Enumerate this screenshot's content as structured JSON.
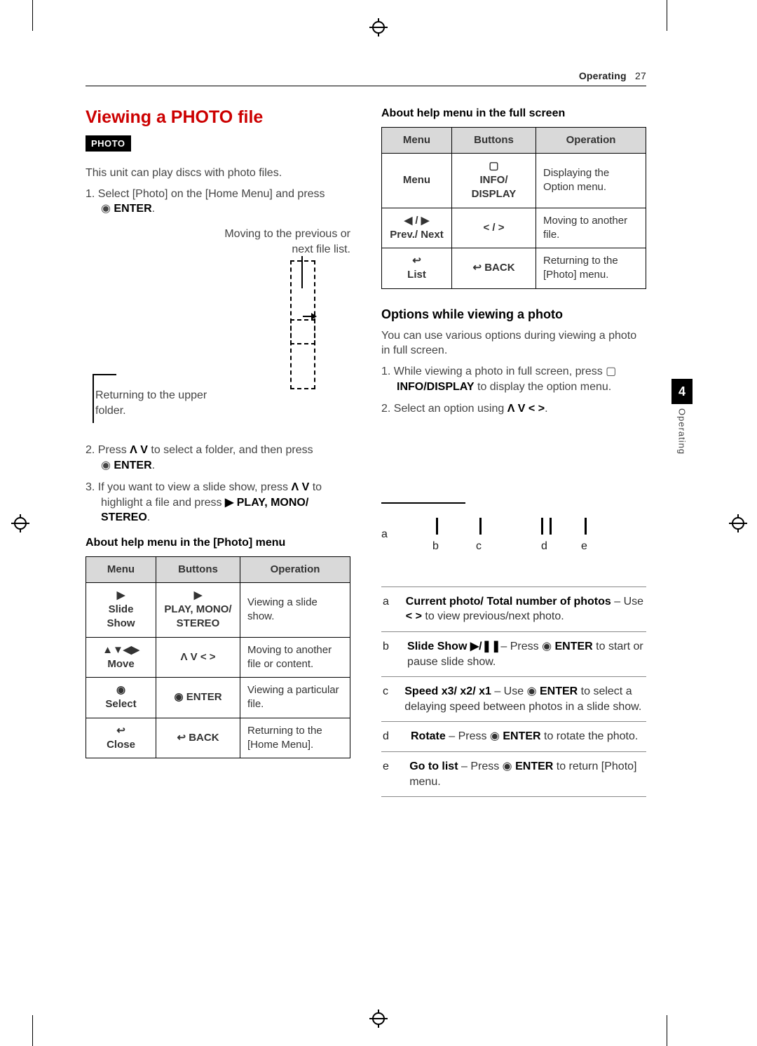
{
  "running_head": {
    "section": "Operating",
    "page": "27"
  },
  "side_tab": {
    "number": "4",
    "label": "Operating"
  },
  "left": {
    "title": "Viewing a PHOTO file",
    "badge": "PHOTO",
    "intro": "This unit can play discs with photo files.",
    "step1_num": "1.",
    "step1_a": "Select [Photo] on the [Home Menu] and press ",
    "step1_enter": "ENTER",
    "step1_b": ".",
    "diagram_cap1": "Moving to the previous or next file list.",
    "diagram_cap2": "Returning to the upper folder.",
    "step2_num": "2.",
    "step2_a": "Press ",
    "step2_sym": "Λ V",
    "step2_b": " to select a folder, and then press ",
    "step2_enter": "ENTER",
    "step2_c": ".",
    "step3_num": "3.",
    "step3_a": "If you want to view a slide show, press ",
    "step3_sym": "Λ V",
    "step3_b": " to highlight a file and press ",
    "step3_play_sym": "▶",
    "step3_play": " PLAY, MONO/ STEREO",
    "step3_c": ".",
    "table1_title": "About help menu in the [Photo] menu",
    "table1": {
      "h1": "Menu",
      "h2": "Buttons",
      "h3": "Operation",
      "r1c1_sym": "▶",
      "r1c1": "Slide Show",
      "r1c2_sym": "▶",
      "r1c2": "PLAY, MONO/ STEREO",
      "r1c3": "Viewing a slide show.",
      "r2c1_sym": "▲▼◀▶",
      "r2c1": "Move",
      "r2c2": "Λ V < >",
      "r2c3": "Moving to another file or content.",
      "r3c1_sym": "◉",
      "r3c1": "Select",
      "r3c2_sym": "◉",
      "r3c2": "ENTER",
      "r3c3": "Viewing a particular file.",
      "r4c1_sym": "↩",
      "r4c1": "Close",
      "r4c2_sym": "↩",
      "r4c2": "BACK",
      "r4c3": "Returning to the [Home Menu]."
    }
  },
  "right": {
    "table2_title": "About help menu in the full screen",
    "table2": {
      "h1": "Menu",
      "h2": "Buttons",
      "h3": "Operation",
      "r1c1": "Menu",
      "r1c2_sym": "▢",
      "r1c2": "INFO/ DISPLAY",
      "r1c3": "Displaying the Option menu.",
      "r2c1_sym": "◀ / ▶",
      "r2c1": "Prev./ Next",
      "r2c2": "< / >",
      "r2c3": "Moving to another file.",
      "r3c1_sym": "↩",
      "r3c1": "List",
      "r3c2_sym": "↩",
      "r3c2": "BACK",
      "r3c3": "Returning to the [Photo] menu."
    },
    "h3": "Options while viewing a photo",
    "p1": "You can use various options during viewing a photo in full screen.",
    "s1_num": "1.",
    "s1_a": "While viewing a photo in full screen, press ",
    "s1_sym": "▢",
    "s1_b": " INFO/DISPLAY",
    "s1_c": " to display the option menu.",
    "s2_num": "2.",
    "s2_a": "Select an option using ",
    "s2_sym": "Λ V < >",
    "s2_b": ".",
    "labels": {
      "a": "a",
      "b": "b",
      "c": "c",
      "d": "d",
      "e": "e"
    },
    "opt_a_b": "Current photo/ Total number of photos",
    "opt_a_t": " – Use ",
    "opt_a_sym": "< >",
    "opt_a_t2": " to view previous/next photo.",
    "opt_b_b": "Slide Show ",
    "opt_b_sym": "▶/❚❚",
    "opt_b_t": "– Press ",
    "opt_b_enter_sym": "◉",
    "opt_b_enter": " ENTER",
    "opt_b_t2": " to start or pause slide show.",
    "opt_c_b": "Speed x3/ x2/ x1",
    "opt_c_t": " – Use ",
    "opt_c_sym": "◉",
    "opt_c_enter": " ENTER",
    "opt_c_t2": " to select a delaying speed between photos in a slide show.",
    "opt_d_b": "Rotate",
    "opt_d_t": " – Press ",
    "opt_d_sym": "◉",
    "opt_d_enter": " ENTER",
    "opt_d_t2": " to rotate the photo.",
    "opt_e_b": "Go to list",
    "opt_e_t": " – Press ",
    "opt_e_sym": "◉",
    "opt_e_enter": " ENTER",
    "opt_e_t2": " to return [Photo] menu."
  }
}
